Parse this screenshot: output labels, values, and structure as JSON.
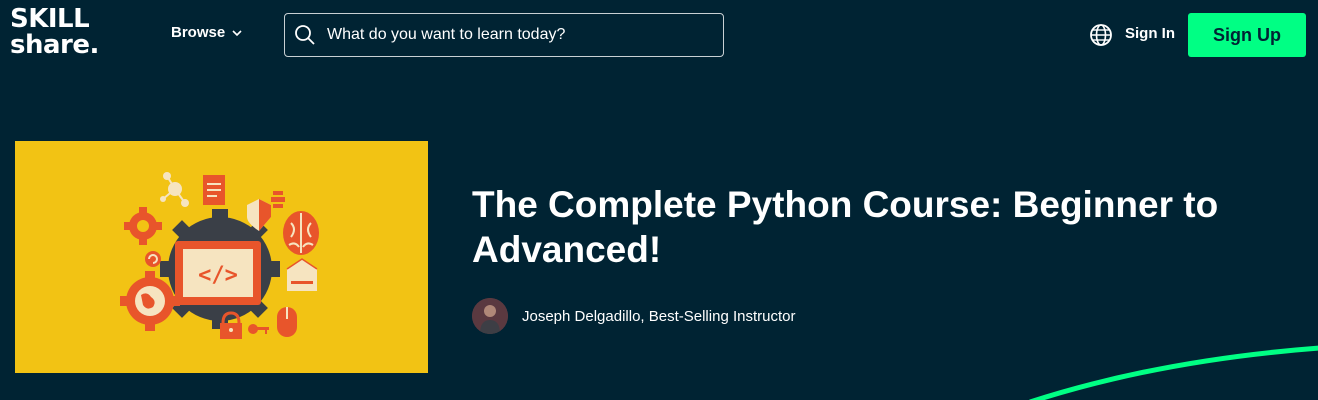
{
  "header": {
    "logo_line1": "SKILL",
    "logo_line2": "share.",
    "browse_label": "Browse",
    "search_placeholder": "What do you want to learn today?",
    "signin_label": "Sign In",
    "signup_label": "Sign Up"
  },
  "course": {
    "title_line1": "The Complete Python Course: Beginner to",
    "title_line2": "Advanced!",
    "instructor": "Joseph Delgadillo, Best-Selling Instructor",
    "thumbnail_code_symbol": "</>"
  },
  "colors": {
    "background": "#002333",
    "accent": "#00ff84",
    "thumbnail_bg": "#f2c314",
    "icon_orange": "#e8552b",
    "icon_dark": "#3a3f47"
  },
  "icons": [
    "search-icon",
    "chevron-down-icon",
    "globe-icon",
    "code-icon",
    "gear-icon",
    "brain-icon",
    "shield-icon",
    "lock-icon",
    "mouse-icon",
    "globe-gear-icon",
    "document-icon",
    "network-icon",
    "envelope-icon"
  ]
}
